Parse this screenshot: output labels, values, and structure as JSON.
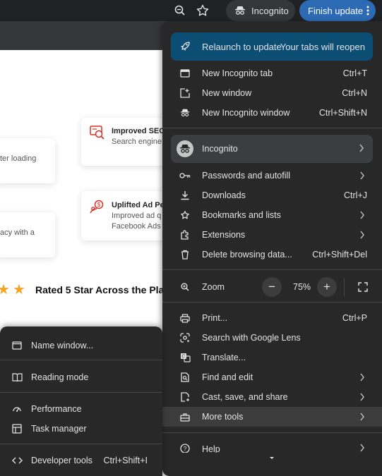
{
  "toolbar": {
    "incognito_label": "Incognito",
    "finish_update_label": "Finish update"
  },
  "page": {
    "card1_text": "ter loading",
    "card2_title": "Improved SEO",
    "card2_text": "Search engine",
    "card3_text": "acy with a",
    "card4_title": "Uplifted Ad Pe",
    "card4_line1": "Improved ad q",
    "card4_line2": "Facebook Ads",
    "rated_text": "Rated 5 Star Across the Plat"
  },
  "menu": {
    "relaunch": {
      "label": "Relaunch to update",
      "note": "Your tabs will reopen"
    },
    "items_top": [
      {
        "label": "New Incognito tab",
        "shortcut": "Ctrl+T",
        "icon": "new-tab-icon"
      },
      {
        "label": "New window",
        "shortcut": "Ctrl+N",
        "icon": "new-window-icon"
      },
      {
        "label": "New Incognito window",
        "shortcut": "Ctrl+Shift+N",
        "icon": "incognito-icon"
      }
    ],
    "profile_label": "Incognito",
    "items_mid": [
      {
        "label": "Passwords and autofill",
        "shortcut": "",
        "icon": "key-icon"
      },
      {
        "label": "Downloads",
        "shortcut": "Ctrl+J",
        "icon": "download-icon"
      },
      {
        "label": "Bookmarks and lists",
        "shortcut": "",
        "icon": "star-icon"
      },
      {
        "label": "Extensions",
        "shortcut": "",
        "icon": "puzzle-icon"
      },
      {
        "label": "Delete browsing data...",
        "shortcut": "Ctrl+Shift+Del",
        "icon": "trash-icon"
      }
    ],
    "zoom": {
      "label": "Zoom",
      "value": "75%",
      "minus": "−",
      "plus": "+"
    },
    "items_bottom": [
      {
        "label": "Print...",
        "shortcut": "Ctrl+P",
        "icon": "print-icon"
      },
      {
        "label": "Search with Google Lens",
        "shortcut": "",
        "icon": "lens-icon"
      },
      {
        "label": "Translate...",
        "shortcut": "",
        "icon": "translate-icon"
      },
      {
        "label": "Find and edit",
        "shortcut": "",
        "icon": "find-icon"
      },
      {
        "label": "Cast, save, and share",
        "shortcut": "",
        "icon": "cast-icon"
      },
      {
        "label": "More tools",
        "shortcut": "",
        "icon": "toolbox-icon"
      }
    ],
    "help_label": "Help"
  },
  "submenu": {
    "items": [
      {
        "label": "Name window...",
        "shortcut": "",
        "icon": "window-icon"
      },
      {
        "label": "Reading mode",
        "shortcut": "",
        "icon": "book-icon"
      },
      {
        "label": "Performance",
        "shortcut": "",
        "icon": "gauge-icon"
      },
      {
        "label": "Task manager",
        "shortcut": "",
        "icon": "task-manager-icon"
      },
      {
        "label": "Developer tools",
        "shortcut": "Ctrl+Shift+I",
        "icon": "code-icon"
      }
    ]
  },
  "colors": {
    "menu_bg": "#282828",
    "relaunch_bg": "#0b4d73",
    "accent_button": "#2d6ab4",
    "star": "#f4a623",
    "promo_icon": "#d93025"
  }
}
